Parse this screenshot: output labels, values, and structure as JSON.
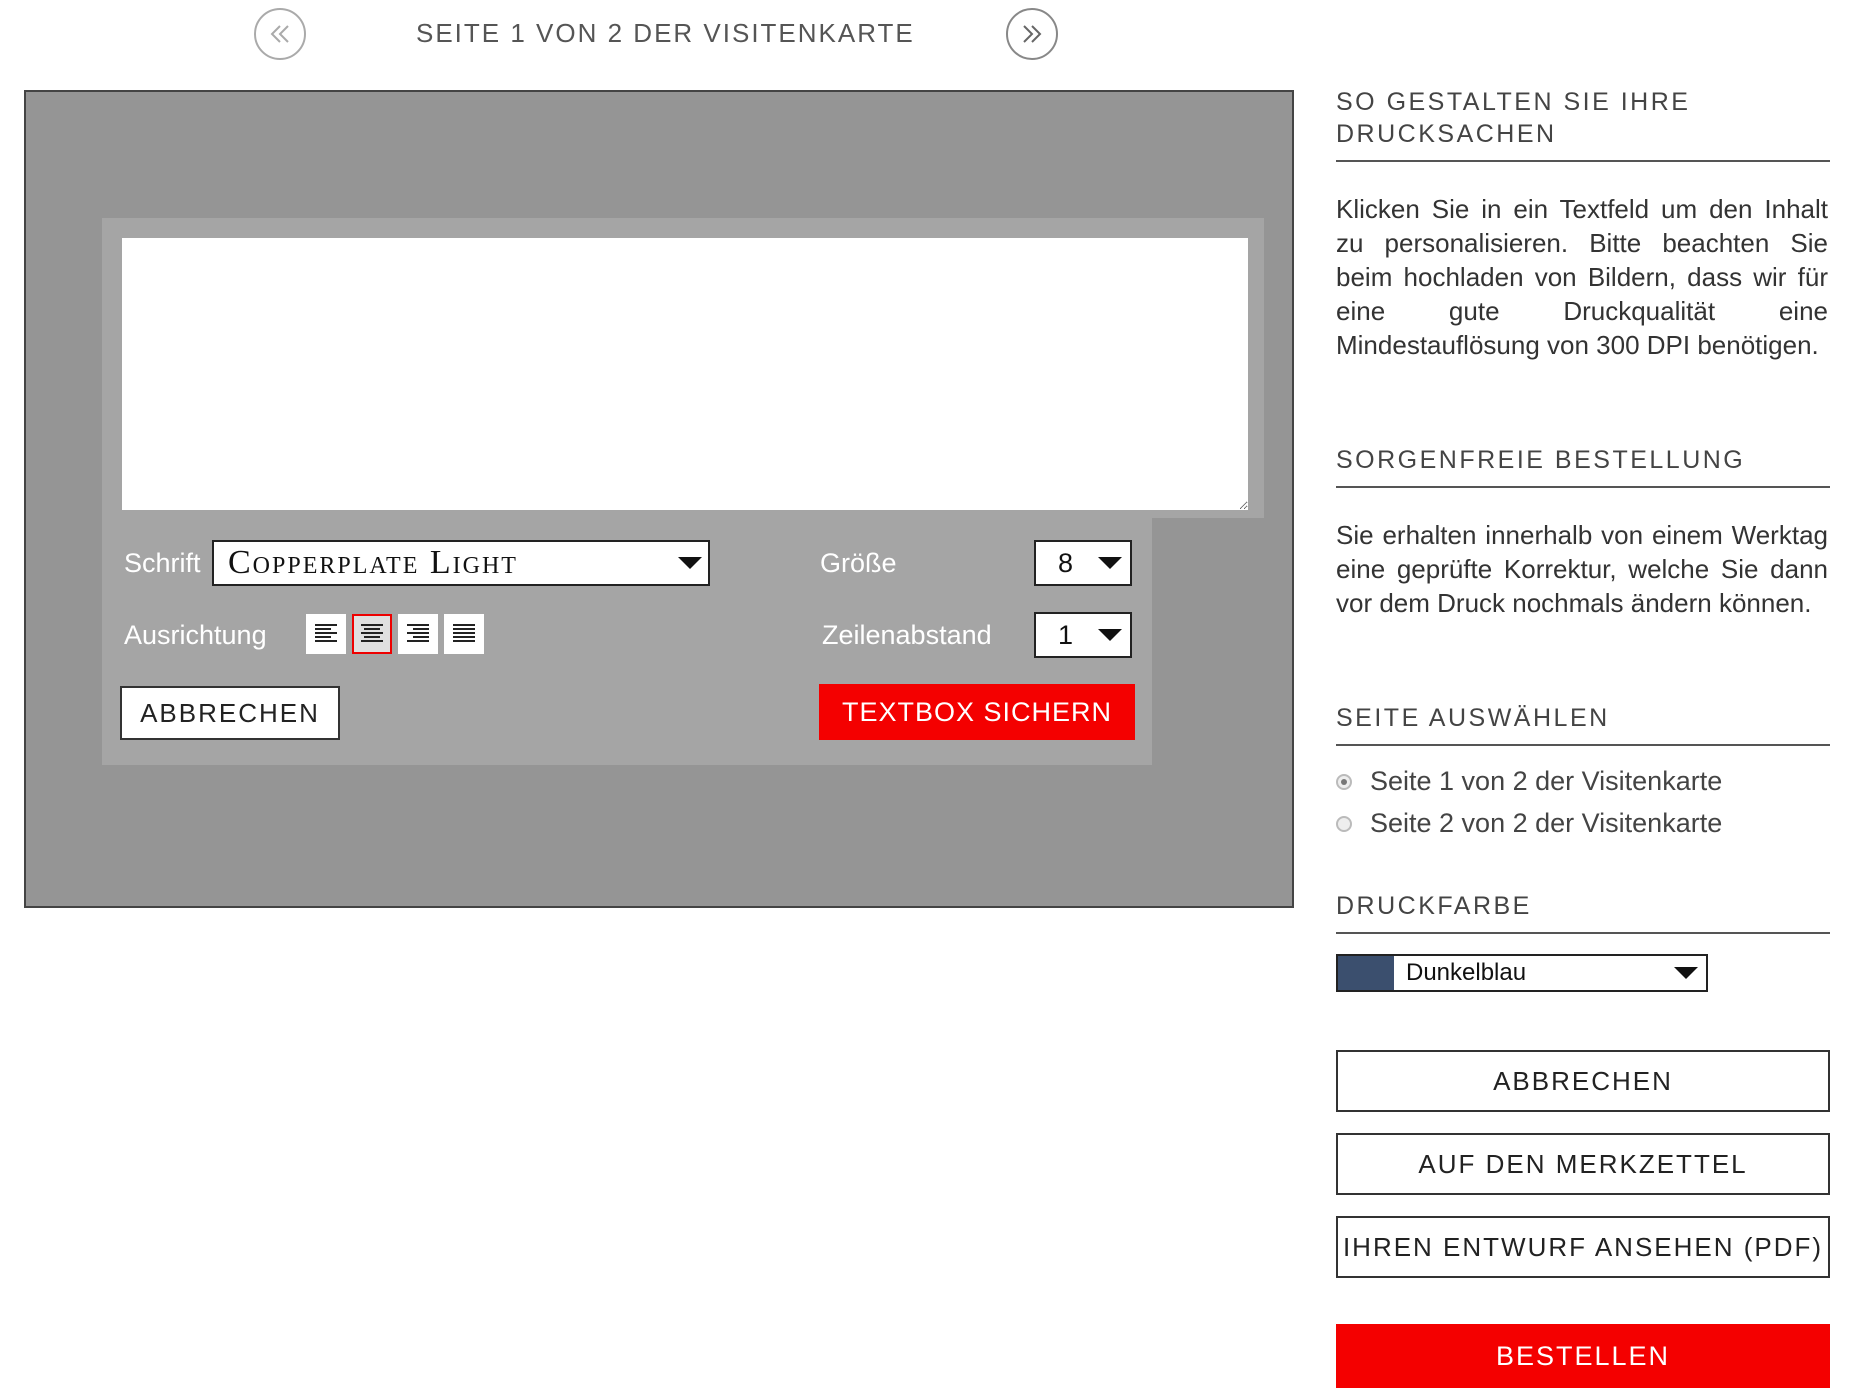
{
  "pager": {
    "title": "SEITE 1 VON 2 DER VISITENKARTE",
    "prev_icon": "double-chevron-left",
    "next_icon": "double-chevron-right"
  },
  "editor": {
    "text_value": "",
    "font_label": "Schrift",
    "font_value": "Copperplate Light",
    "size_label": "Größe",
    "size_value": "8",
    "align_label": "Ausrichtung",
    "align_options": [
      "align-left",
      "align-center",
      "align-right",
      "align-justify"
    ],
    "align_selected": "align-center",
    "line_spacing_label": "Zeilenabstand",
    "line_spacing_value": "1",
    "cancel_label": "ABBRECHEN",
    "save_label": "TEXTBOX SICHERN"
  },
  "sidebar": {
    "howto": {
      "heading": "SO GESTALTEN SIE IHRE DRUCKSACHEN",
      "text": "Klicken Sie in ein Textfeld um den Inhalt zu personalisieren. Bitte beachten Sie beim hochladen von Bildern, dass wir für eine gute Druckqualität eine Mindestauflösung von 300 DPI benötigen."
    },
    "order": {
      "heading": "SORGENFREIE BESTELLUNG",
      "text": "Sie erhalten innerhalb von einem Werktag eine geprüfte Korrektur, welche Sie dann vor dem Druck nochmals ändern können."
    },
    "pages": {
      "heading": "SEITE AUSWÄHLEN",
      "options": [
        "Seite 1 von 2 der Visitenkarte",
        "Seite 2 von 2 der Visitenkarte"
      ],
      "selected_index": 0
    },
    "color": {
      "heading": "DRUCKFARBE",
      "value": "Dunkelblau",
      "swatch": "#3b4f6e"
    },
    "buttons": {
      "cancel": "ABBRECHEN",
      "wishlist": "AUF DEN MERKZETTEL",
      "preview": "IHREN ENTWURF ANSEHEN (PDF)",
      "order": "BESTELLEN"
    }
  },
  "colors": {
    "accent_red": "#f40000",
    "canvas_gray": "#959595",
    "panel_gray": "#a5a5a5"
  }
}
